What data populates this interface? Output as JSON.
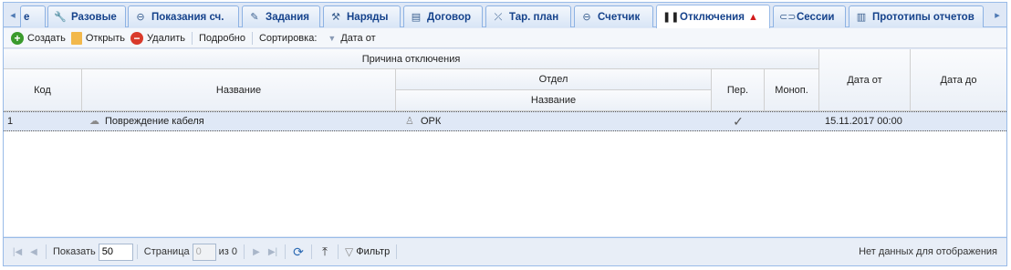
{
  "tabs": [
    {
      "icon": "arrow-left-icon",
      "label": "е"
    },
    {
      "icon": "wrench-icon",
      "label": "Разовые"
    },
    {
      "icon": "minus-circle-icon",
      "label": "Показания сч."
    },
    {
      "icon": "notepad-icon",
      "label": "Задания"
    },
    {
      "icon": "tools-icon",
      "label": "Наряды"
    },
    {
      "icon": "contract-icon",
      "label": "Договор"
    },
    {
      "icon": "tariff-icon",
      "label": "Тар. план"
    },
    {
      "icon": "meter-icon",
      "label": "Счетчик"
    },
    {
      "icon": "pause-icon",
      "label": "Отключения"
    },
    {
      "icon": "link-icon",
      "label": "Сессии"
    },
    {
      "icon": "report-icon",
      "label": "Прототипы отчетов"
    }
  ],
  "toolbar": {
    "create": "Создать",
    "open": "Открыть",
    "delete": "Удалить",
    "details": "Подробно",
    "sort_label": "Сортировка:",
    "sort_field": "Дата от"
  },
  "grid": {
    "group_reason": "Причина отключения",
    "col_code": "Код",
    "col_name": "Название",
    "group_dept": "Отдел",
    "col_dept_name": "Название",
    "col_per": "Пер.",
    "col_monop": "Моноп.",
    "col_date_from": "Дата от",
    "col_date_to": "Дата до",
    "rows": [
      {
        "code": "1",
        "name": "Повреждение кабеля",
        "dept": "ОРК",
        "per": "✓",
        "monop": "",
        "date_from": "15.11.2017 00:00",
        "date_to": ""
      }
    ]
  },
  "pager": {
    "show_label": "Показать",
    "page_size": "50",
    "page_label": "Страница",
    "page": "0",
    "of_label": "из 0",
    "filter_label": "Фильтр",
    "empty_text": "Нет данных для отображения"
  },
  "colors": {
    "accent": "#15428b",
    "selected_row": "#dfe8f6",
    "warning": "#d21b1b"
  }
}
